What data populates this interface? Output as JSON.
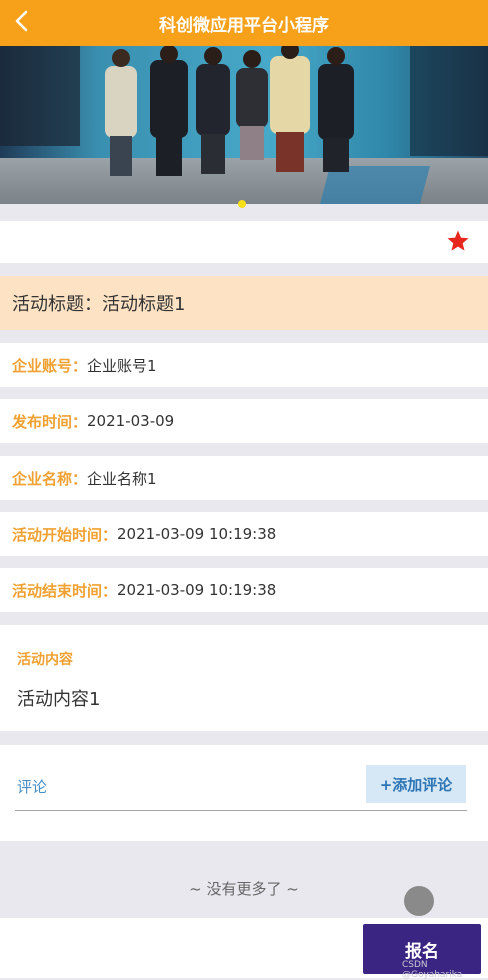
{
  "header": {
    "title": "科创微应用平台小程序",
    "back_icon": "chevron-left-icon"
  },
  "banner": {
    "image": "group-photo",
    "active_indicator": 1,
    "colors": {
      "indicator": "#f7e018"
    }
  },
  "favorite": {
    "icon": "star-icon",
    "color": "#e8271c"
  },
  "activity": {
    "title_label": "活动标题：",
    "title_value": "活动标题1"
  },
  "fields": [
    {
      "label": "企业账号：",
      "value": "企业账号1"
    },
    {
      "label": "发布时间：",
      "value": "2021-03-09"
    },
    {
      "label": "企业名称：",
      "value": "企业名称1"
    },
    {
      "label": "活动开始时间：",
      "value": "2021-03-09 10:19:38"
    },
    {
      "label": "活动结束时间：",
      "value": "2021-03-09 10:19:38"
    }
  ],
  "content": {
    "label": "活动内容",
    "value": "活动内容1"
  },
  "comments": {
    "label": "评论",
    "add_button": "+添加评论"
  },
  "footer": {
    "no_more": "~ 没有更多了 ~",
    "signup_button": "报名",
    "watermark": "CSDN @Goyaharika"
  },
  "colors": {
    "header": "#f7a01a",
    "accent_label": "#f0a132",
    "signup": "#3b2583",
    "title_bg": "#fde3c4"
  }
}
